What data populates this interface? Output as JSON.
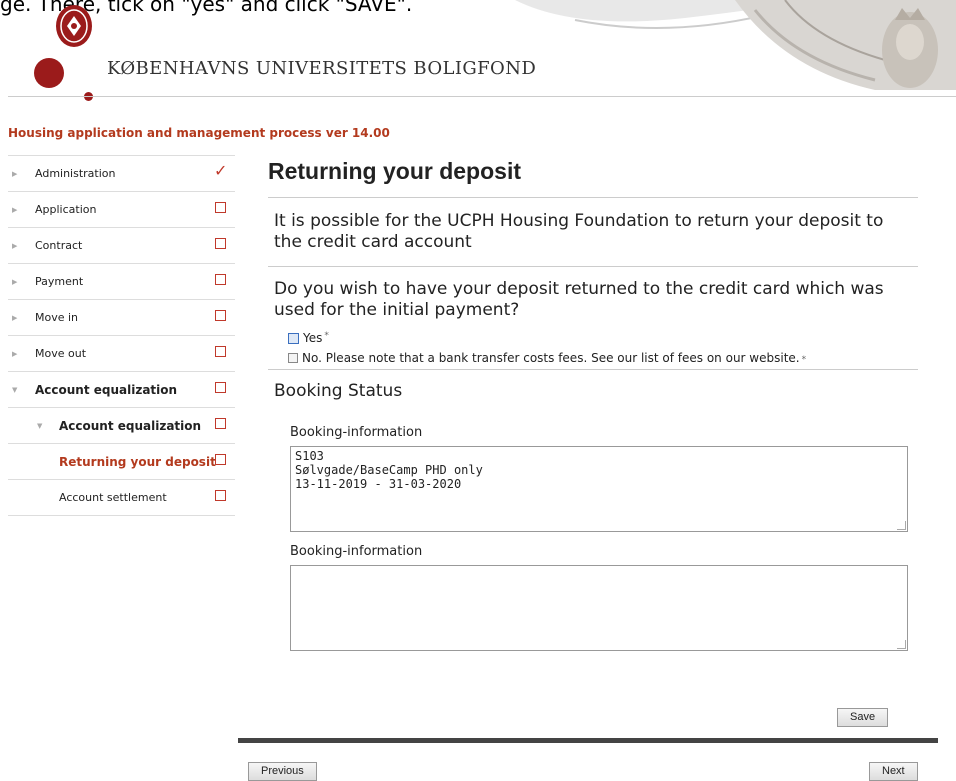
{
  "caption": "ge. There, tick on \"yes\" and click \"SAVE\".",
  "header": {
    "org_name": "KØBENHAVNS UNIVERSITETS BOLIGFOND",
    "brand_color": "#9b1b1b"
  },
  "process_title": "Housing application and management process ver 14.00",
  "sidebar": {
    "items": [
      {
        "label": "Administration",
        "status": "done"
      },
      {
        "label": "Application",
        "status": "todo"
      },
      {
        "label": "Contract",
        "status": "todo"
      },
      {
        "label": "Payment",
        "status": "todo"
      },
      {
        "label": "Move in",
        "status": "todo"
      },
      {
        "label": "Move out",
        "status": "todo"
      },
      {
        "label": "Account equalization",
        "status": "todo"
      },
      {
        "label": "Account equalization",
        "status": "todo"
      },
      {
        "label": "Returning your deposit",
        "status": "todo"
      },
      {
        "label": "Account settlement",
        "status": "todo"
      }
    ]
  },
  "main": {
    "heading": "Returning your deposit",
    "intro": "It is possible for the UCPH Housing Foundation to return your deposit to the credit card account",
    "question": "Do you wish to have your deposit returned to the credit card which was used for the initial payment?",
    "options": [
      {
        "label": "Yes",
        "required_mark": "*"
      },
      {
        "label": "No. Please note that a bank transfer costs fees. See our list of fees on our website.",
        "required_mark": "*"
      }
    ],
    "booking_section": "Booking Status",
    "booking_label_1": "Booking-information",
    "booking_value_1": "S103\nSølvgade/BaseCamp PHD only\n13-11-2019 - 31-03-2020",
    "booking_label_2": "Booking-information",
    "booking_value_2": "",
    "save_label": "Save",
    "previous_label": "Previous",
    "next_label": "Next"
  }
}
